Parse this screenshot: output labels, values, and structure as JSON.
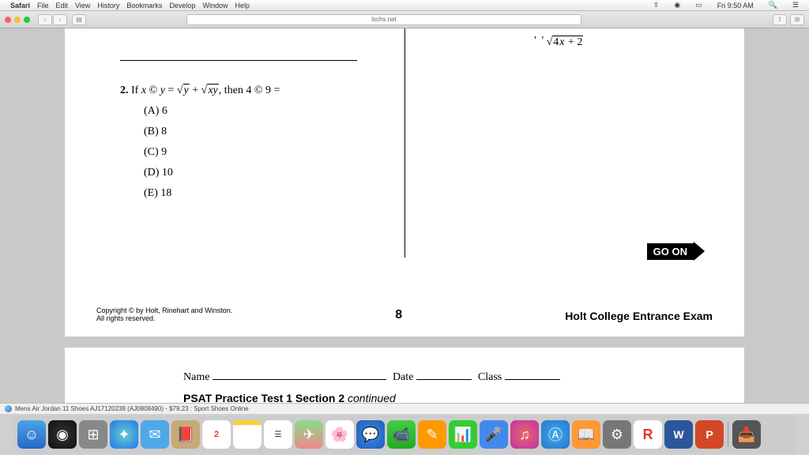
{
  "menubar": {
    "app": "Safari",
    "items": [
      "File",
      "Edit",
      "View",
      "History",
      "Bookmarks",
      "Develop",
      "Window",
      "Help"
    ],
    "clock": "Fri 9:50 AM"
  },
  "toolbar": {
    "url": "lschs.net"
  },
  "page1": {
    "expr_top": "√(4x + 2)",
    "question": {
      "num": "2.",
      "text_prefix": "If ",
      "text_mid": " © ",
      "text_eq": " = ",
      "text_plus": " + ",
      "text_then": ", then 4 © 9 =",
      "var_x": "x",
      "var_y": "y",
      "sqrt_y": "y",
      "sqrt_xy": "xy"
    },
    "choices": {
      "a": "(A) 6",
      "b": "(B) 8",
      "c": "(C) 9",
      "d": "(D) 10",
      "e": "(E) 18"
    },
    "goon": "GO ON",
    "copyright_l1": "Copyright © by Holt, Rinehart and Winston.",
    "copyright_l2": "All rights reserved.",
    "pagenum": "8",
    "exam": "Holt College Entrance Exam"
  },
  "page2": {
    "name": "Name",
    "date": "Date",
    "class": "Class",
    "title": "PSAT Practice Test 1 Section 2",
    "cont": " continued"
  },
  "status": {
    "text": "Mens Air Jordan 11 Shoes AJ17120238 (AJ0808490) - $79.23 : Sport Shoes Online"
  }
}
